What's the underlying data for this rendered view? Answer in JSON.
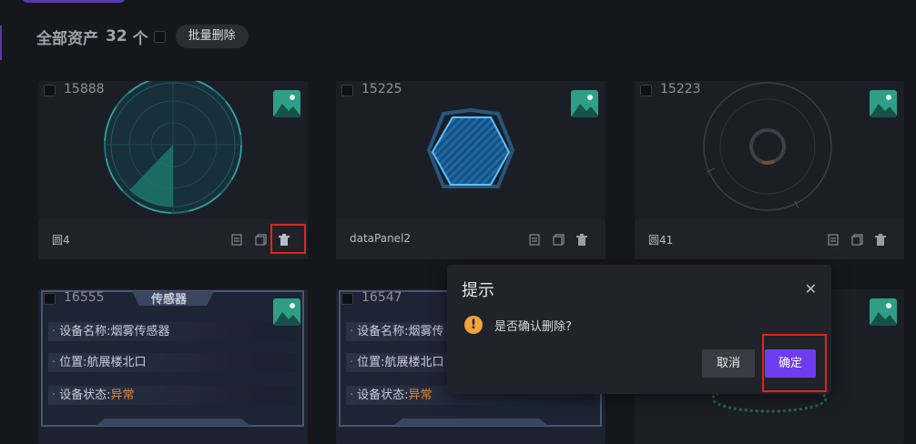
{
  "header": {
    "title": "全部资产",
    "count": "32",
    "unit": "个",
    "batch_delete_label": "批量删除"
  },
  "cards": [
    {
      "id": "15888",
      "name": "圆4"
    },
    {
      "id": "15225",
      "name": "dataPanel2"
    },
    {
      "id": "15223",
      "name": "圆41"
    },
    {
      "id": "16555"
    },
    {
      "id": "16547"
    }
  ],
  "sensor": {
    "title": "传感器",
    "rows": [
      {
        "label": "设备名称:",
        "value": "烟雾传感器"
      },
      {
        "label": "位置:",
        "value": "航展楼北口"
      },
      {
        "label": "设备状态:",
        "value": "异常"
      }
    ],
    "rows_truncated": [
      {
        "label": "设备名称:",
        "value": "烟雾传"
      },
      {
        "label": "位置:",
        "value": "航展楼北口"
      },
      {
        "label": "设备状态:",
        "value": "异常"
      }
    ]
  },
  "dialog": {
    "title": "提示",
    "message": "是否确认删除?",
    "cancel_label": "取消",
    "confirm_label": "确定"
  },
  "colors": {
    "accent": "#6e3df0",
    "highlight": "#e0251c",
    "warning": "#f0a43a",
    "status_abnormal": "#e08a3a"
  }
}
